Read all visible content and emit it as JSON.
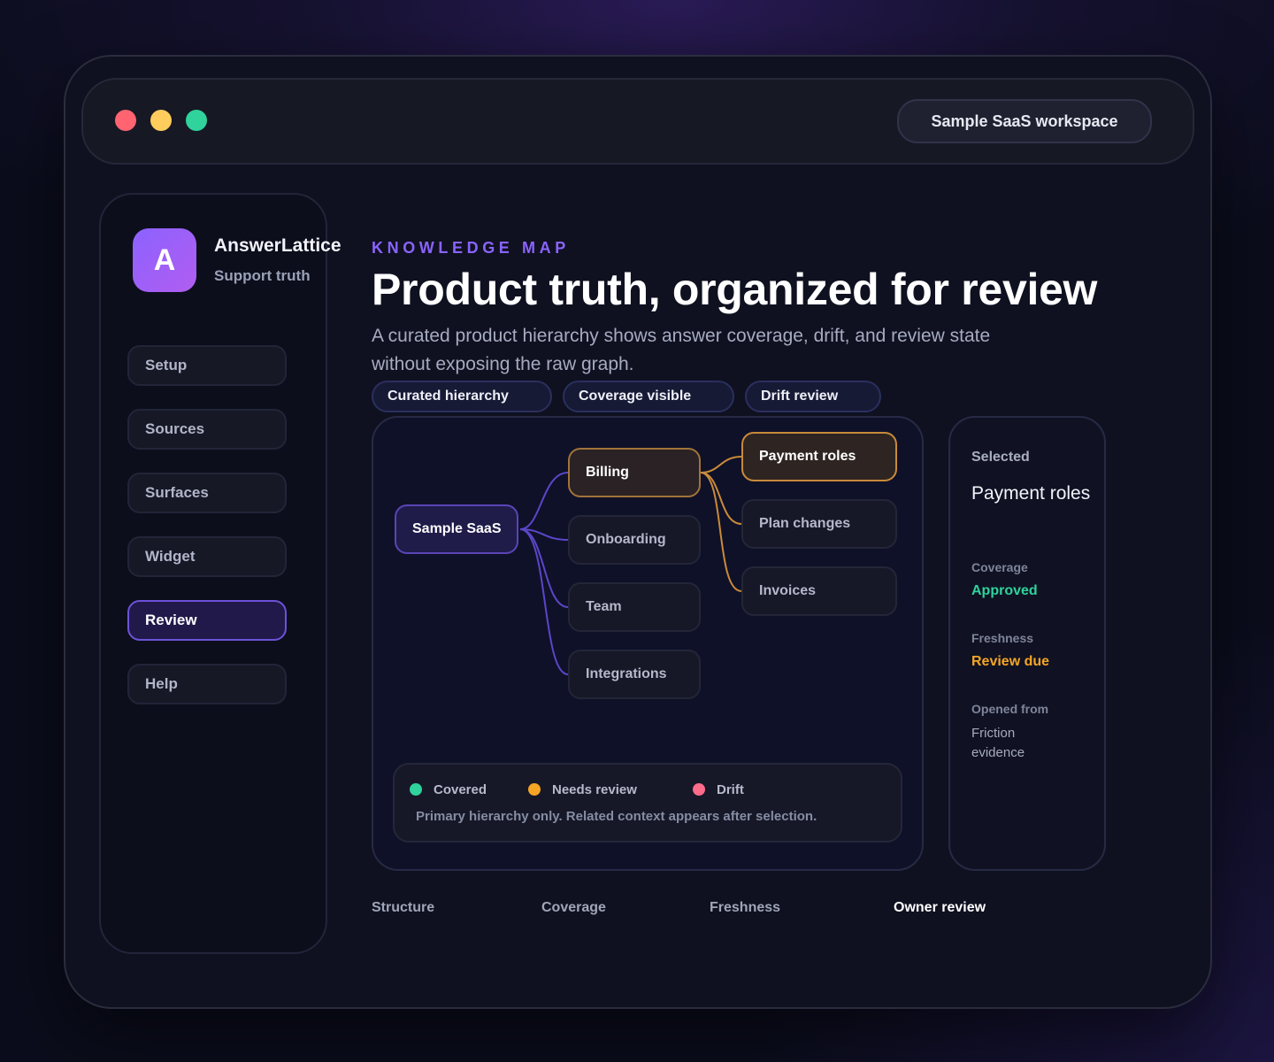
{
  "window": {
    "workspace_label": "Sample SaaS workspace"
  },
  "sidebar": {
    "logo_letter": "A",
    "brand": "AnswerLattice",
    "brand_sub": "Support truth",
    "items": [
      {
        "label": "Setup"
      },
      {
        "label": "Sources"
      },
      {
        "label": "Surfaces"
      },
      {
        "label": "Widget"
      },
      {
        "label": "Review",
        "active": true
      },
      {
        "label": "Help"
      }
    ]
  },
  "header": {
    "eyebrow": "KNOWLEDGE MAP",
    "title": "Product truth, organized for review",
    "subtitle": "A curated product hierarchy shows answer coverage, drift, and review state without exposing the raw graph."
  },
  "chips": [
    "Curated hierarchy",
    "Coverage visible",
    "Drift review"
  ],
  "map": {
    "root": "Sample SaaS",
    "branches": [
      "Billing",
      "Onboarding",
      "Team",
      "Integrations"
    ],
    "billing_children": [
      "Payment roles",
      "Plan changes",
      "Invoices"
    ]
  },
  "legend": {
    "items": [
      {
        "label": "Covered",
        "color": "#2fd39b"
      },
      {
        "label": "Needs review",
        "color": "#f5a524"
      },
      {
        "label": "Drift",
        "color": "#ff6b8a"
      }
    ],
    "note": "Primary hierarchy only. Related context appears after selection."
  },
  "detail": {
    "selected_label": "Selected",
    "title": "Payment roles",
    "coverage_label": "Coverage",
    "coverage_value": "Approved",
    "freshness_label": "Freshness",
    "freshness_value": "Review due",
    "opened_label": "Opened from",
    "opened_value": "Friction evidence"
  },
  "footer_tabs": [
    "Structure",
    "Coverage",
    "Freshness",
    "Owner review"
  ],
  "colors": {
    "accent": "#8a63ff",
    "approved": "#2fd39b",
    "review_due": "#f5a524",
    "tree_line": "#5b46c9",
    "tree_line_hot": "#c98a3a"
  }
}
